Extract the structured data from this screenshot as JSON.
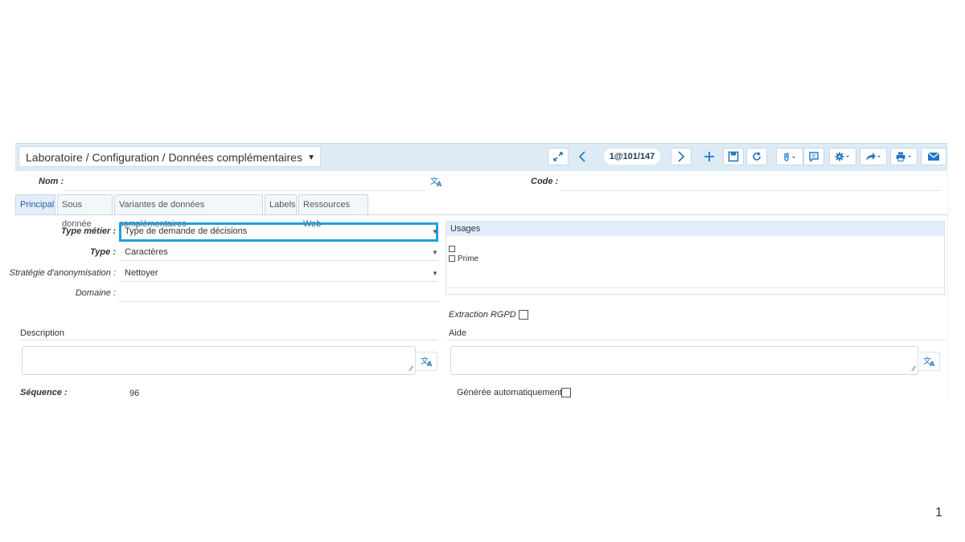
{
  "toolbar": {
    "breadcrumb": "Laboratoire / Configuration / Données complémentaires",
    "record_position": "1@101/147"
  },
  "header": {
    "nom_label": "Nom :",
    "nom_value": "",
    "code_label": "Code :",
    "code_value": ""
  },
  "tabs": [
    {
      "label": "Principal",
      "active": true
    },
    {
      "label": "Sous donnée",
      "active": false
    },
    {
      "label": "Variantes de données complémentaires",
      "active": false
    },
    {
      "label": "Labels",
      "active": false
    },
    {
      "label": "Ressources Web",
      "active": false
    }
  ],
  "form": {
    "type_metier_label": "Type métier :",
    "type_metier_value": "Type de demande de décisions",
    "type_label": "Type :",
    "type_value": "Caractères",
    "strategie_label": "Stratégie d'anonymisation :",
    "strategie_value": "Nettoyer",
    "domaine_label": "Domaine :",
    "domaine_value": "",
    "description_label": "Description",
    "aide_label": "Aide",
    "sequence_label": "Séquence :",
    "sequence_value": "96",
    "extraction_label": "Extraction RGPD :",
    "generee_label": "Générée automatiquement :"
  },
  "usages": {
    "title": "Usages",
    "items": [
      "",
      "Prime"
    ]
  },
  "slide_number": "1",
  "colors": {
    "accent": "#1f78c8",
    "highlight": "#1ea0e0",
    "toolbar_bg": "#ddebf7"
  }
}
